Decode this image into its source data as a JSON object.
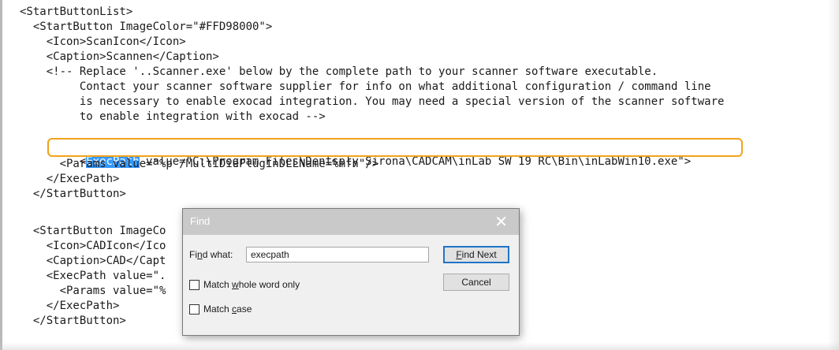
{
  "code_lines": [
    "<StartButtonList>",
    "  <StartButton ImageColor=\"#FFD98000\">",
    "    <Icon>ScanIcon</Icon>",
    "    <Caption>Scannen</Caption>",
    "    <!-- Replace '..Scanner.exe' below by the complete path to your scanner software executable.",
    "         Contact your scanner software supplier for info on what additional configuration / command line",
    "         is necessary to enable exocad integration. You may need a special version of the scanner software",
    "         to enable integration with exocad -->",
    "    ",
    "      <Params value=\"%p /MultiDiePluginDLLName=%mfn\"/>",
    "    </ExecPath>",
    "  </StartButton>",
    "",
    "  <StartButton ImageCo",
    "    <Icon>CADIcon</Ico",
    "    <Caption>CAD</Capt",
    "    <ExecPath value=\".",
    "      <Params value=\"%",
    "    </ExecPath>",
    "  </StartButton>"
  ],
  "exec_line": {
    "lt": "<",
    "highlighted": "ExecPath",
    "rest": " value=\"C:\\Program Files\\Dentsply Sirona\\CADCAM\\inLab SW 19 RC\\Bin\\inLabWin10.exe\">"
  },
  "find_dialog": {
    "title": "Find",
    "close_glyph": "✕",
    "find_what_label_pre": "Fi",
    "find_what_label_u": "n",
    "find_what_label_post": "d what:",
    "find_value": "execpath",
    "find_next_u": "F",
    "find_next_rest": "ind Next",
    "cancel_label": "Cancel",
    "match_whole_pre": "Match ",
    "match_whole_u": "w",
    "match_whole_post": "hole word only",
    "match_case_pre": "Match ",
    "match_case_u": "c",
    "match_case_post": "ase"
  },
  "colors": {
    "selection": "#3399ff",
    "outline": "#f3a21c",
    "dialog_title_bg": "#c9c9c9"
  }
}
